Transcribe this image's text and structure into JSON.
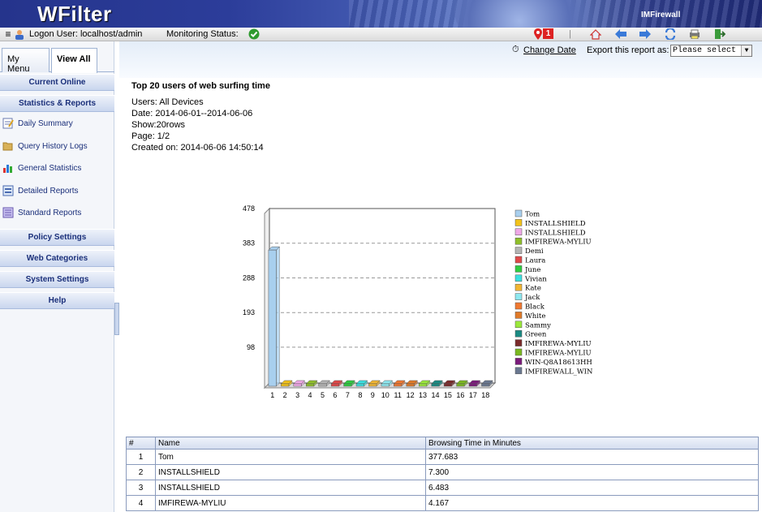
{
  "header": {
    "logo": "WFilter",
    "product": "IMFirewall"
  },
  "status_bar": {
    "logon_label": "Logon User: localhost/admin",
    "monitoring_label": "Monitoring Status:",
    "alert_count": "1"
  },
  "sidebar": {
    "tabs": [
      {
        "label": "My Menu"
      },
      {
        "label": "View All"
      }
    ],
    "sections": {
      "current_online": "Current Online",
      "statistics": "Statistics & Reports",
      "policy": "Policy Settings",
      "web_categories": "Web Categories",
      "system": "System Settings",
      "help": "Help"
    },
    "items": [
      {
        "label": "Daily Summary",
        "icon": "notepad-icon"
      },
      {
        "label": "Query History Logs",
        "icon": "folder-icon"
      },
      {
        "label": "General Statistics",
        "icon": "bar-chart-icon"
      },
      {
        "label": "Detailed Reports",
        "icon": "report-icon"
      },
      {
        "label": "Standard Reports",
        "icon": "list-icon"
      }
    ]
  },
  "toolbar": {
    "change_date": "Change Date",
    "export_label": "Export this report as:",
    "export_value": "Please select"
  },
  "report": {
    "title": "Top 20 users of web surfing time",
    "users": "Users: All Devices",
    "date": "Date:   2014-06-01--2014-06-06",
    "show": "Show:20rows",
    "page": "Page:  1/2",
    "created": "Created on:  2014-06-06 14:50:14"
  },
  "chart_data": {
    "type": "bar",
    "categories": [
      "1",
      "2",
      "3",
      "4",
      "5",
      "6",
      "7",
      "8",
      "9",
      "10",
      "11",
      "12",
      "13",
      "14",
      "15",
      "16",
      "17",
      "18"
    ],
    "values": [
      377.683,
      7.3,
      6.483,
      4.167,
      4.0,
      3.9,
      3.8,
      3.7,
      3.6,
      3.5,
      3.4,
      3.3,
      3.2,
      3.1,
      3.0,
      2.9,
      2.8,
      2.7
    ],
    "y_ticks": [
      98,
      193,
      288,
      383,
      478
    ],
    "ylim": [
      0,
      478
    ],
    "legend": [
      "Tom",
      "INSTALLSHIELD",
      "INSTALLSHIELD",
      "IMFIREWA-MYLIU",
      "Demi",
      "Laura",
      "June",
      "Vivian",
      "Kate",
      "Jack",
      "Black",
      "White",
      "Sammy",
      "Green",
      "IMFIREWA-MYLIU",
      "IMFIREWA-MYLIU",
      "WIN-Q8A18613HHU",
      "IMFIREWALL_WINS"
    ],
    "colors": [
      "#a8cfee",
      "#f2c21a",
      "#f0a8e8",
      "#8fbf2a",
      "#b4b4b4",
      "#e04848",
      "#2ecc40",
      "#3ae0e0",
      "#f2b632",
      "#8ee8f0",
      "#f07830",
      "#e07a28",
      "#9ae83a",
      "#1a8a82",
      "#7a2a2a",
      "#7ab820",
      "#7a1a7a",
      "#6a7890"
    ],
    "legend_position": "right"
  },
  "table": {
    "headers": [
      "#",
      "Name",
      "Browsing Time in Minutes"
    ],
    "rows": [
      [
        "1",
        "Tom",
        "377.683"
      ],
      [
        "2",
        "INSTALLSHIELD",
        "7.300"
      ],
      [
        "3",
        "INSTALLSHIELD",
        "6.483"
      ],
      [
        "4",
        "IMFIREWA-MYLIU",
        "4.167"
      ]
    ]
  }
}
